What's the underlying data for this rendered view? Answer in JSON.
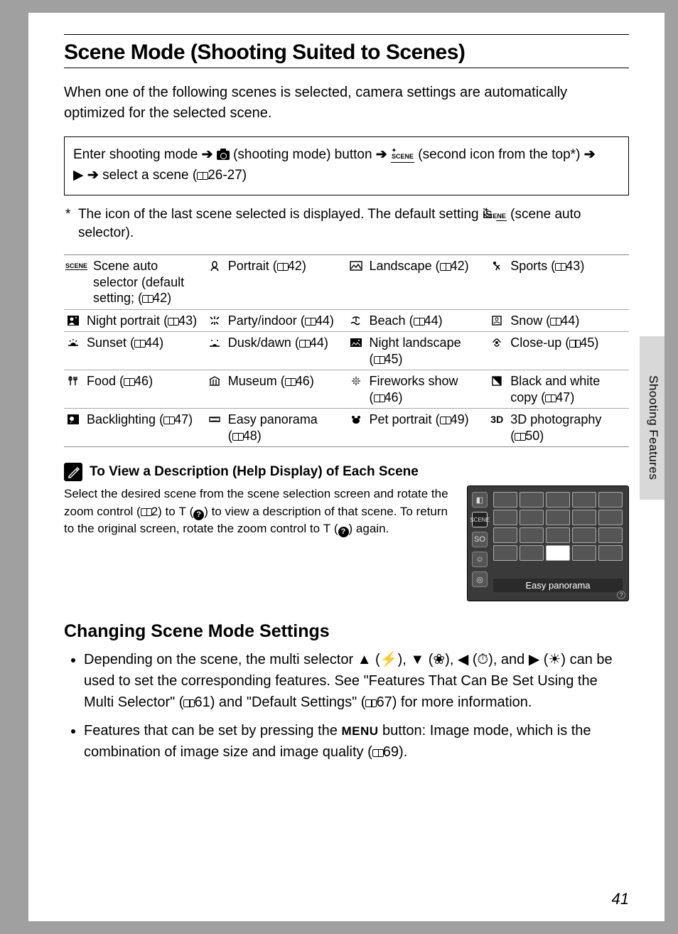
{
  "side_tab_label": "Shooting Features",
  "title": "Scene Mode (Shooting Suited to Scenes)",
  "intro": "When one of the following scenes is selected, camera settings are automatically optimized for the selected scene.",
  "instruction": {
    "t1": "Enter shooting mode ",
    "t2": " (shooting mode) button ",
    "t3": " (second icon from the top*) ",
    "t4": " select a scene (",
    "ref": "26-27",
    "t5": ")"
  },
  "footnote": "*  The icon of the last scene selected is displayed. The default setting is  (scene auto selector).",
  "scenes": [
    [
      {
        "label": "Scene auto selector (default setting; ",
        "ref": "42",
        "close": ")",
        "icon": "scene-auto-icon"
      },
      {
        "label": "Portrait",
        "ref": "42",
        "icon": "portrait-icon"
      },
      {
        "label": "Landscape",
        "ref": "42",
        "icon": "landscape-icon"
      },
      {
        "label": "Sports",
        "ref": "43",
        "icon": "sports-icon"
      }
    ],
    [
      {
        "label": "Night portrait",
        "ref": "43",
        "icon": "night-portrait-icon"
      },
      {
        "label": "Party/indoor",
        "ref": "44",
        "icon": "party-icon"
      },
      {
        "label": "Beach",
        "ref": "44",
        "icon": "beach-icon"
      },
      {
        "label": "Snow",
        "ref": "44",
        "icon": "snow-icon"
      }
    ],
    [
      {
        "label": "Sunset",
        "ref": "44",
        "icon": "sunset-icon"
      },
      {
        "label": "Dusk/dawn",
        "ref": "44",
        "icon": "dusk-icon"
      },
      {
        "label": "Night landscape",
        "ref": "45",
        "icon": "night-landscape-icon"
      },
      {
        "label": "Close-up",
        "ref": "45",
        "icon": "closeup-icon"
      }
    ],
    [
      {
        "label": "Food",
        "ref": "46",
        "icon": "food-icon"
      },
      {
        "label": "Museum",
        "ref": "46",
        "icon": "museum-icon"
      },
      {
        "label": "Fireworks show",
        "ref": "46",
        "icon": "fireworks-icon"
      },
      {
        "label": "Black and white copy",
        "ref": "47",
        "icon": "bw-copy-icon"
      }
    ],
    [
      {
        "label": "Backlighting",
        "ref": "47",
        "icon": "backlight-icon"
      },
      {
        "label": "Easy panorama",
        "ref": "48",
        "icon": "panorama-icon"
      },
      {
        "label": "Pet portrait",
        "ref": "49",
        "icon": "pet-icon"
      },
      {
        "label": "3D photography",
        "ref": "50",
        "icon": "3d-icon",
        "icontext": "3D"
      }
    ]
  ],
  "help_title": "To View a Description (Help Display) of Each Scene",
  "help_text": {
    "t1": "Select the desired scene from the scene selection screen and rotate the zoom control (",
    "r1": "2",
    "t2": ") to ",
    "tbold": "T",
    "t3": " (",
    "t4": ") to view a description of that scene. To return to the original screen, rotate the zoom control to ",
    "t5": " (",
    "t6": ") again."
  },
  "lcd_label": "Easy panorama",
  "subhead": "Changing Scene Mode Settings",
  "bullets": [
    {
      "pre": "Depending on the scene, the multi selector ",
      "mid": " can be used to set the corresponding features. See \"Features That Can Be Set Using the Multi Selector\" (",
      "r1": "61",
      "mid2": ") and \"Default Settings\" (",
      "r2": "67",
      "post": ") for more information."
    },
    {
      "pre": "Features that can be set by pressing the ",
      "menu": "MENU",
      "mid": " button: Image mode, which is the combination of image size and image quality (",
      "r1": "69",
      "post": ")."
    }
  ],
  "page_number": "41"
}
